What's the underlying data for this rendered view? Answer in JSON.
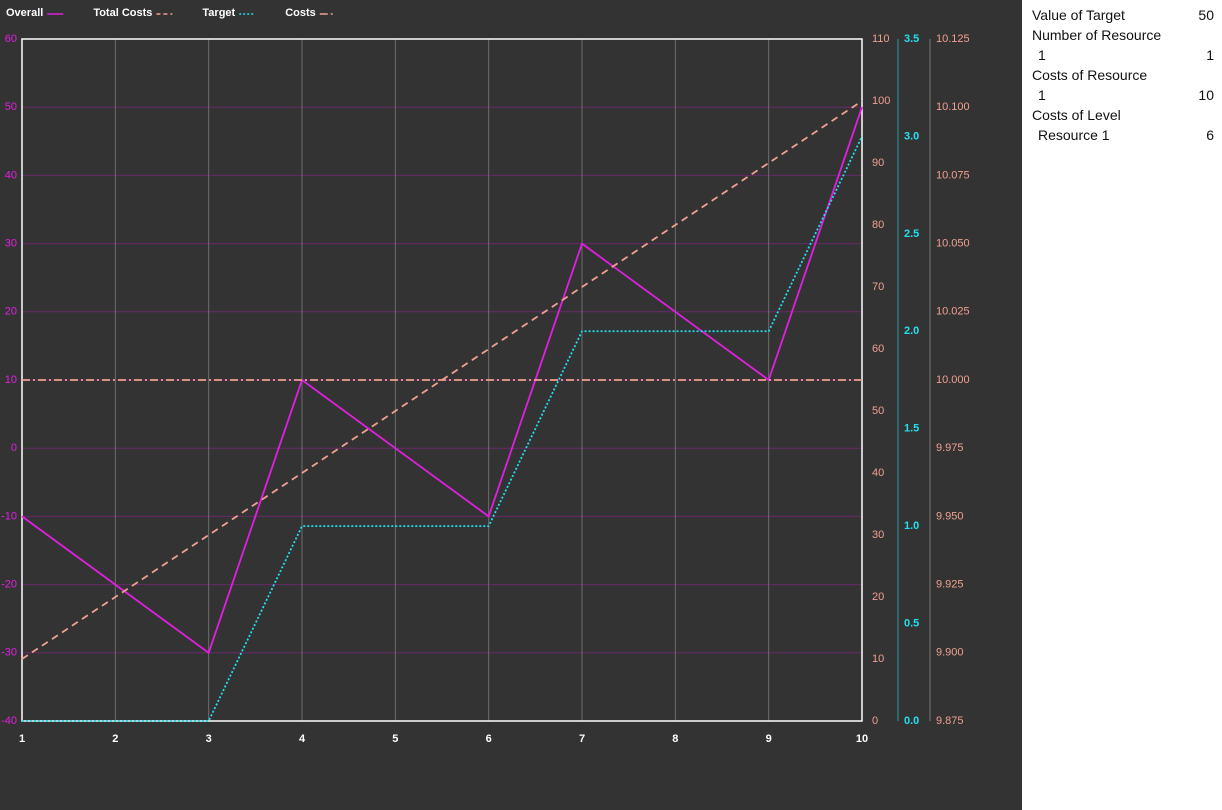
{
  "chart_data": {
    "type": "line",
    "x": [
      1,
      2,
      3,
      4,
      5,
      6,
      7,
      8,
      9,
      10
    ],
    "xlim": [
      1,
      10
    ],
    "grid": true,
    "legend_position": "top-left",
    "axes": {
      "left": {
        "min": -40,
        "max": 60,
        "ticks": [
          -40,
          -30,
          -20,
          -10,
          0,
          10,
          20,
          30,
          40,
          50,
          60
        ],
        "color": "#e020e0"
      },
      "right1": {
        "min": 0,
        "max": 110,
        "ticks": [
          0,
          10,
          20,
          30,
          40,
          50,
          60,
          70,
          80,
          90,
          100,
          110
        ],
        "color": "#f0a090"
      },
      "right2": {
        "min": 0,
        "max": 3.5,
        "ticks": [
          "0.0",
          "0.5",
          "1.0",
          "1.5",
          "2.0",
          "2.5",
          "3.0",
          "3.5"
        ],
        "color": "#20e0f0"
      },
      "right3": {
        "min": 9.875,
        "max": 10.125,
        "ticks": [
          "9.875",
          "9.900",
          "9.925",
          "9.950",
          "9.975",
          "10.000",
          "10.025",
          "10.050",
          "10.075",
          "10.100",
          "10.125"
        ],
        "color": "#f0a090"
      }
    },
    "series": [
      {
        "name": "Overall",
        "axis": "left",
        "style": "solid",
        "color": "#e020e0",
        "values": [
          -10,
          -20,
          -30,
          10,
          0,
          -10,
          30,
          20,
          10,
          50
        ]
      },
      {
        "name": "Total Costs",
        "axis": "right1",
        "style": "dashed",
        "color": "#f0a090",
        "values": [
          10,
          20,
          30,
          40,
          50,
          60,
          70,
          80,
          90,
          100
        ]
      },
      {
        "name": "Target",
        "axis": "right2",
        "style": "dotted",
        "color": "#20e0f0",
        "step": true,
        "values": [
          0,
          0,
          0,
          1,
          1,
          1,
          2,
          2,
          2,
          3
        ]
      },
      {
        "name": "Costs",
        "axis": "right3",
        "style": "dashdot",
        "color": "#f0a090",
        "values": [
          10,
          10,
          10,
          10,
          10,
          10,
          10,
          10,
          10,
          10
        ]
      }
    ]
  },
  "panel": {
    "rows": [
      {
        "label": "Value of Target",
        "value": "50"
      },
      {
        "label": "Number of Resource",
        "value": "",
        "header": true
      },
      {
        "label": "1",
        "value": "1",
        "sub": true
      },
      {
        "label": "Costs of Resource",
        "value": "",
        "header": true
      },
      {
        "label": "1",
        "value": "10",
        "sub": true
      },
      {
        "label": "Costs of Level",
        "value": "",
        "header": true
      },
      {
        "label": "Resource 1",
        "value": "6",
        "sub": true
      }
    ]
  }
}
